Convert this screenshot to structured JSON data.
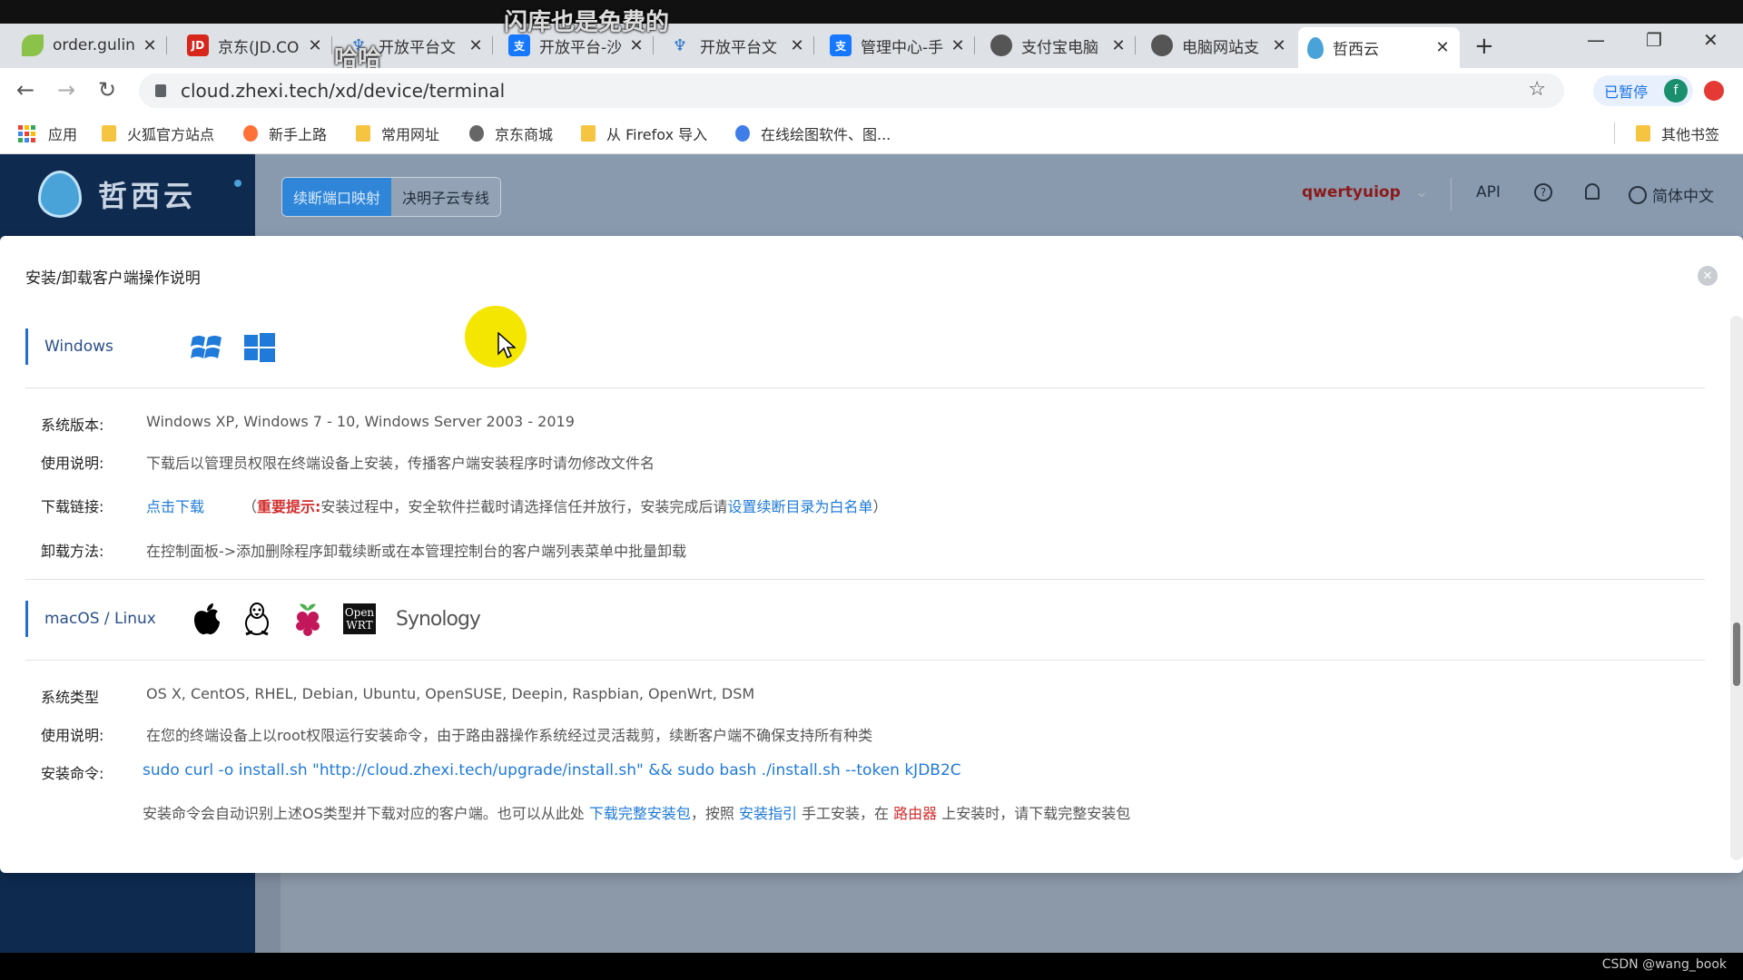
{
  "browser": {
    "tabs": [
      {
        "title": "order.gulin",
        "fav": "leaf",
        "color": "#8bc34a"
      },
      {
        "title": "京东(JD.CO",
        "fav": "JD",
        "color": "#d7261b"
      },
      {
        "title": "开放平台文",
        "fav": "ant",
        "color": "#2a73c9"
      },
      {
        "title": "开放平台-沙",
        "fav": "支",
        "color": "#1677ff"
      },
      {
        "title": "开放平台文",
        "fav": "ant",
        "color": "#2a73c9"
      },
      {
        "title": "管理中心-手",
        "fav": "支",
        "color": "#1677ff"
      },
      {
        "title": "支付宝电脑",
        "fav": "globe",
        "color": "#555555"
      },
      {
        "title": "电脑网站支",
        "fav": "globe",
        "color": "#555555"
      },
      {
        "title": "哲西云",
        "fav": "drop",
        "color": "#4aa3d8"
      }
    ],
    "overlay_text_1": "闪库也是免费的",
    "overlay_text_2": "哈哈",
    "url": "cloud.zhexi.tech/xd/device/terminal",
    "paused_label": "已暂停",
    "avatar_letter": "f",
    "bookmarks": {
      "apps": "应用",
      "items": [
        "火狐官方站点",
        "新手上路",
        "常用网址",
        "京东商城",
        "从 Firefox 导入",
        "在线绘图软件、图..."
      ],
      "other": "其他书签"
    }
  },
  "app": {
    "logo_text": "哲西云",
    "segment_active": "续断端口映射",
    "segment_inactive": "决明子云专线",
    "username": "qwertyuiop",
    "api": "API",
    "language": "简体中文"
  },
  "modal": {
    "title": "安装/卸载客户端操作说明",
    "windows": {
      "heading": "Windows",
      "version_label": "系统版本:",
      "version_value": "Windows XP, Windows 7 - 10, Windows Server 2003 - 2019",
      "usage_label": "使用说明:",
      "usage_value": "下载后以管理员权限在终端设备上安装，传播客户端安装程序时请勿修改文件名",
      "download_label": "下载链接:",
      "download_link": "点击下载",
      "tip_open": "（",
      "tip_important": "重要提示:",
      "tip_text": " 安装过程中，安全软件拦截时请选择信任并放行，安装完成后请 ",
      "tip_link": "设置续断目录为白名单",
      "tip_close": " ）",
      "uninstall_label": "卸载方法:",
      "uninstall_value": "在控制面板->添加删除程序卸载续断或在本管理控制台的客户端列表菜单中批量卸载"
    },
    "unix": {
      "heading": "macOS / Linux",
      "synology": "Synology",
      "openwrt_1": "Open",
      "openwrt_2": "WRT",
      "type_label": "系统类型",
      "type_value": "OS X, CentOS, RHEL, Debian, Ubuntu, OpenSUSE, Deepin, Raspbian, OpenWrt, DSM",
      "usage_label": "使用说明:",
      "usage_value": "在您的终端设备上以root权限运行安装命令，由于路由器操作系统经过灵活裁剪，续断客户端不确保支持所有种类",
      "cmd_label": "安装命令:",
      "cmd_value": "sudo curl -o install.sh \"http://cloud.zhexi.tech/upgrade/install.sh\" && sudo bash ./install.sh --token kJDB2C",
      "note_1": "安装命令会自动识别上述OS类型并下载对应的客户端。也可以从此处 ",
      "note_link_1": "下载完整安装包",
      "note_2": "，按照 ",
      "note_link_2": "安装指引",
      "note_3": " 手工安装，在 ",
      "note_red": "路由器",
      "note_4": " 上安装时，请下载完整安装包"
    }
  },
  "watermark": "CSDN @wang_book"
}
